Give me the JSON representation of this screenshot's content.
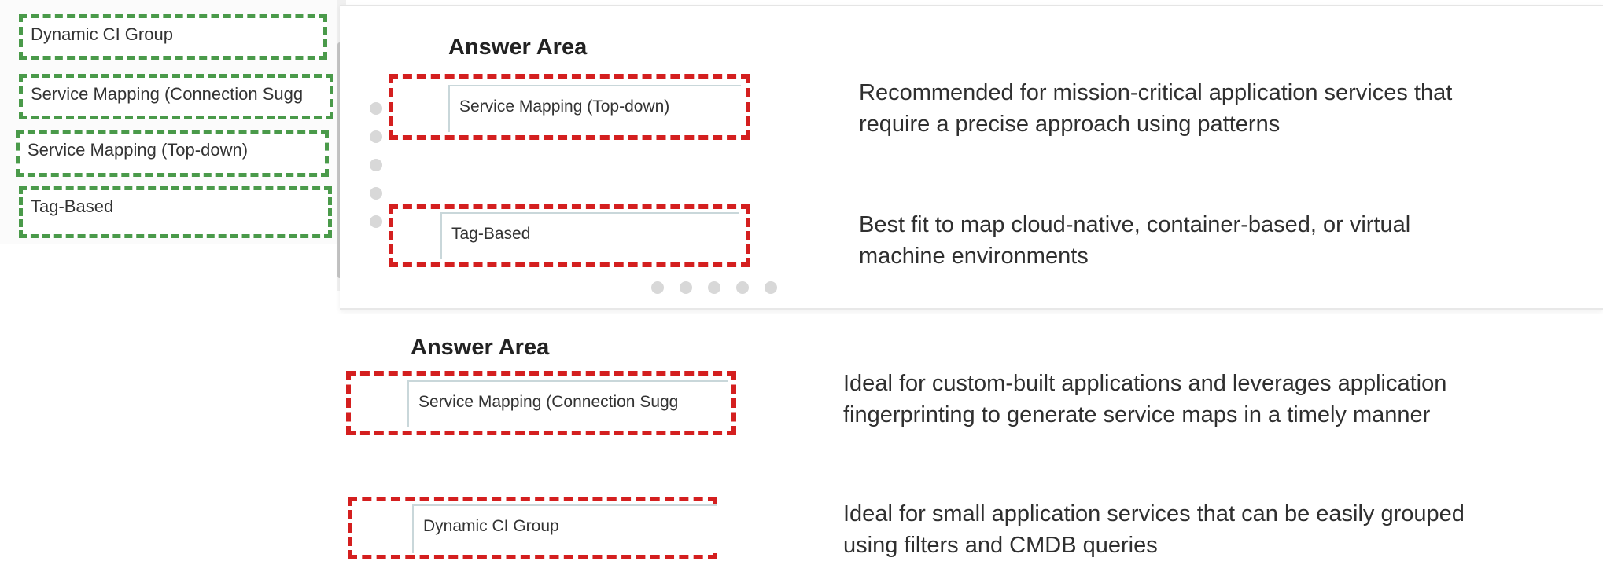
{
  "source_list": {
    "items": [
      {
        "label": "Dynamic CI Group"
      },
      {
        "label": "Service Mapping (Connection Sugg"
      },
      {
        "label": "Service Mapping (Top-down)"
      },
      {
        "label": "Tag-Based"
      }
    ]
  },
  "answer_areas": [
    {
      "title": "Answer Area",
      "rows": [
        {
          "selected": "Service Mapping (Top-down)",
          "description": [
            "Recommended for mission-critical application services that",
            "require a precise approach using patterns"
          ]
        },
        {
          "selected": "Tag-Based",
          "description": [
            "Best fit to map cloud-native, container-based, or virtual",
            "machine environments"
          ]
        }
      ]
    },
    {
      "title": "Answer Area",
      "rows": [
        {
          "selected": "Service Mapping (Connection Sugg",
          "description": [
            "Ideal for custom-built applications and leverages application",
            "fingerprinting to generate service maps in a timely manner"
          ]
        },
        {
          "selected": "Dynamic CI Group",
          "description": [
            "Ideal for small application services that can be easily grouped",
            "using filters and CMDB queries"
          ]
        }
      ]
    }
  ],
  "colors": {
    "source_border": "#4a9a4a",
    "drop_zone_border": "#d41f1f"
  }
}
